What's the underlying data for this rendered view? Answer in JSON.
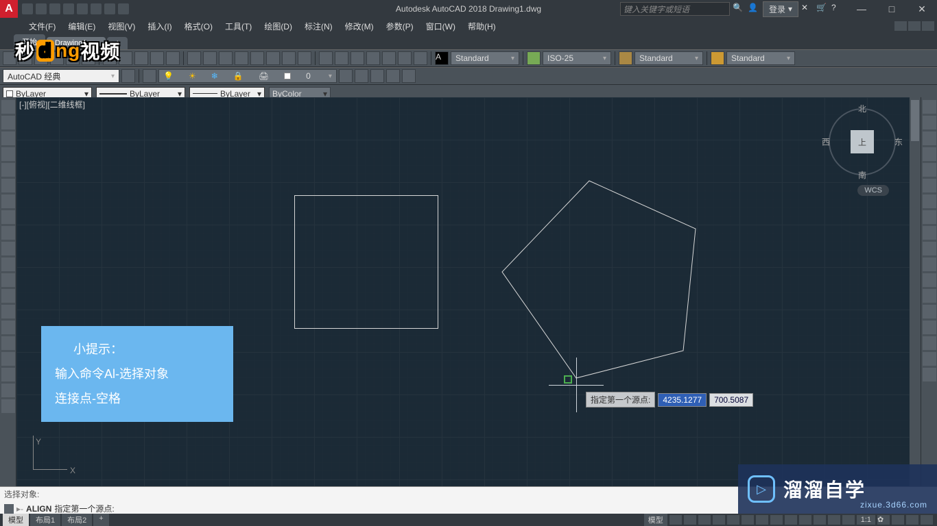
{
  "titlebar": {
    "app_logo": "A",
    "title": "Autodesk AutoCAD 2018   Drawing1.dwg",
    "search_placeholder": "键入关键字或短语",
    "login": "登录",
    "win_min": "—",
    "win_max": "□",
    "win_close": "✕"
  },
  "menus": [
    "文件(F)",
    "编辑(E)",
    "视图(V)",
    "插入(I)",
    "格式(O)",
    "工具(T)",
    "绘图(D)",
    "标注(N)",
    "修改(M)",
    "参数(P)",
    "窗口(W)",
    "帮助(H)"
  ],
  "doc_tabs": {
    "start": "开始",
    "drawing": "Drawing1",
    "close": "×",
    "plus": "+"
  },
  "video_watermark": {
    "a": "秒",
    "b": "d",
    "c": "ng",
    "d": "视频"
  },
  "ribbon": {
    "text_style": "Standard",
    "dim_style": "ISO-25",
    "table_style": "Standard",
    "mleader_style": "Standard"
  },
  "workspace_combo": "AutoCAD 经典",
  "layer_combo": "0",
  "props": {
    "color": "ByLayer",
    "linetype": "ByLayer",
    "lineweight": "ByLayer",
    "plotstyle": "ByColor"
  },
  "viewport_label": "[-][俯视][二维线框]",
  "viewcube": {
    "top": "上",
    "n": "北",
    "s": "南",
    "e": "东",
    "w": "西",
    "wcs": "WCS"
  },
  "ucs": {
    "x": "X",
    "y": "Y"
  },
  "hint": {
    "line1": "小提示：",
    "line2": "输入命令Al-选择对象",
    "line3": "连接点-空格"
  },
  "dynamic_input": {
    "label": "指定第一个源点:",
    "x": "4235.1277",
    "y": "700.5087"
  },
  "command": {
    "history": "选择对象:",
    "prompt_cmd": "ALIGN",
    "prompt_rest": "指定第一个源点:"
  },
  "status": {
    "model": "模型",
    "layout1": "布局1",
    "layout2": "布局2",
    "plus": "+",
    "model_btn": "模型",
    "scale": "1:1",
    "gear": "✿"
  },
  "brand": {
    "big": "溜溜自学",
    "small": "zixue.3d66.com",
    "play": "▷"
  }
}
